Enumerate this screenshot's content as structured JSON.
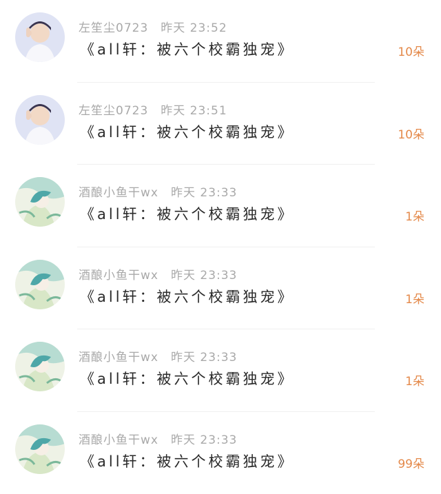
{
  "messages": [
    {
      "sender": "左笙尘0723",
      "time": "昨天 23:52",
      "content": "《all轩：被六个校霸独宠》",
      "count": "10朵",
      "avatar": "person-photo-icon"
    },
    {
      "sender": "左笙尘0723",
      "time": "昨天 23:51",
      "content": "《all轩：被六个校霸独宠》",
      "count": "10朵",
      "avatar": "person-photo-icon"
    },
    {
      "sender": "酒酿小鱼干wx",
      "time": "昨天 23:33",
      "content": "《all轩：被六个校霸独宠》",
      "count": "1朵",
      "avatar": "anime-art-icon"
    },
    {
      "sender": "酒酿小鱼干wx",
      "time": "昨天 23:33",
      "content": "《all轩：被六个校霸独宠》",
      "count": "1朵",
      "avatar": "anime-art-icon"
    },
    {
      "sender": "酒酿小鱼干wx",
      "time": "昨天 23:33",
      "content": "《all轩：被六个校霸独宠》",
      "count": "1朵",
      "avatar": "anime-art-icon"
    },
    {
      "sender": "酒酿小鱼干wx",
      "time": "昨天 23:33",
      "content": "《all轩：被六个校霸独宠》",
      "count": "99朵",
      "avatar": "anime-art-icon"
    }
  ],
  "colors": {
    "meta_text": "#a9a9a9",
    "content_text": "#2a2a2a",
    "count_text": "#e4894a",
    "divider": "#efefef"
  }
}
